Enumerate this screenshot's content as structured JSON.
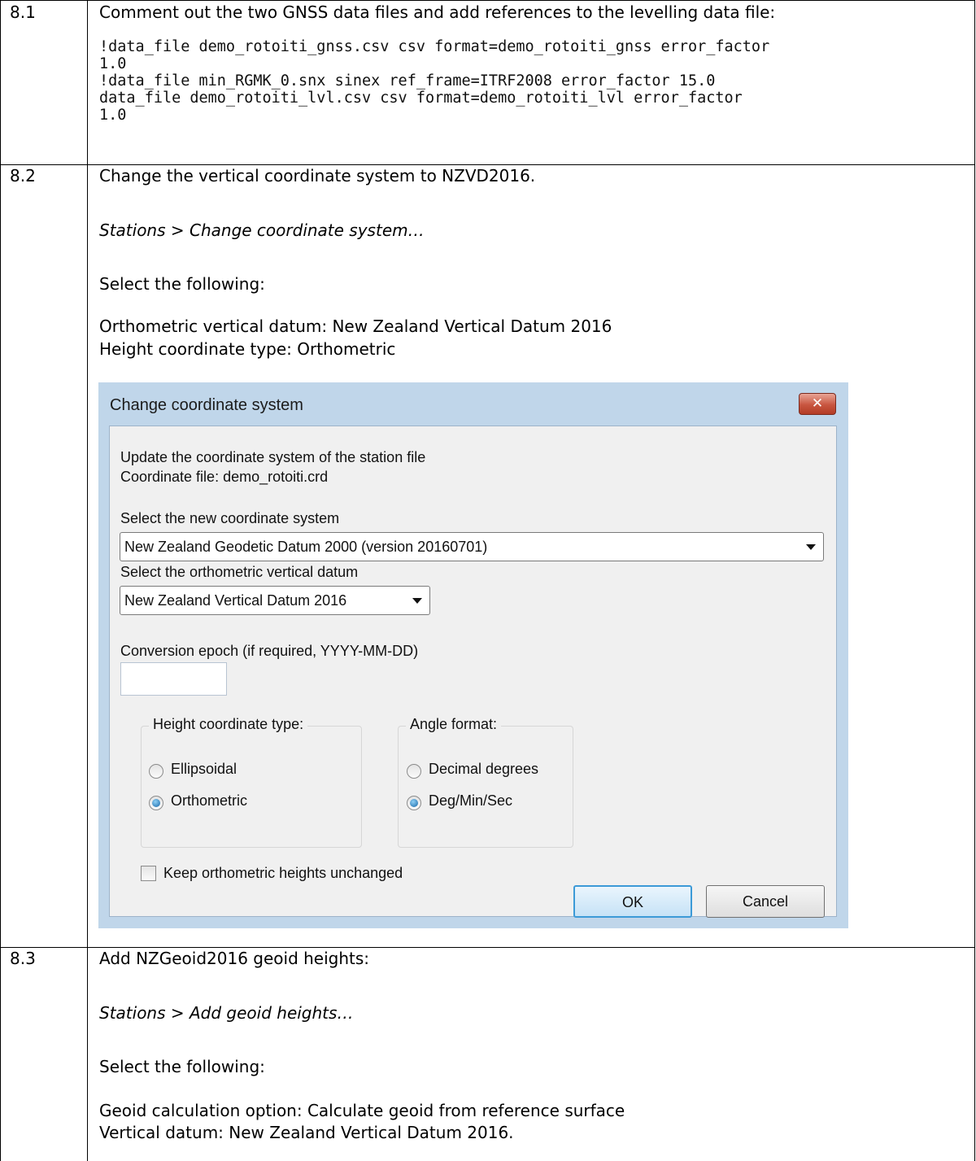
{
  "steps": [
    {
      "number": "8.1",
      "intro": "Comment out the two GNSS data files and add references to the levelling data file:",
      "code_lines": [
        "!data_file demo_rotoiti_gnss.csv csv format=demo_rotoiti_gnss error_factor",
        "1.0",
        "!data_file min_RGMK_0.snx sinex ref_frame=ITRF2008 error_factor 15.0",
        "data_file demo_rotoiti_lvl.csv csv format=demo_rotoiti_lvl error_factor",
        "1.0"
      ]
    },
    {
      "number": "8.2",
      "intro": "Change the vertical coordinate system to NZVD2016.",
      "menu_path": "Stations > Change coordinate system…",
      "select_text": "Select the following:",
      "settings": [
        "Orthometric vertical datum: New Zealand Vertical Datum 2016",
        "Height coordinate type: Orthometric"
      ]
    },
    {
      "number": "8.3",
      "intro": "Add NZGeoid2016 geoid heights:",
      "menu_path": "Stations > Add geoid heights…",
      "select_text": "Select the following:",
      "settings": [
        "Geoid calculation option: Calculate geoid from reference surface",
        "Vertical datum: New Zealand Vertical Datum 2016."
      ]
    }
  ],
  "dialog": {
    "title": "Change coordinate system",
    "close_glyph": "✕",
    "description_line1": "Update the coordinate system of the station file",
    "description_line2": "Coordinate file: demo_rotoiti.crd",
    "coord_system_label": "Select the new coordinate system",
    "coord_system_value": "New Zealand Geodetic Datum 2000 (version 20160701)",
    "vertical_datum_label": "Select the orthometric vertical datum",
    "vertical_datum_value": "New Zealand Vertical Datum 2016",
    "epoch_label": "Conversion epoch (if required, YYYY-MM-DD)",
    "epoch_value": "",
    "height_group": {
      "legend": "Height coordinate type:",
      "options": [
        "Ellipsoidal",
        "Orthometric"
      ],
      "selected": "Orthometric"
    },
    "angle_group": {
      "legend": "Angle format:",
      "options": [
        "Decimal degrees",
        "Deg/Min/Sec"
      ],
      "selected": "Deg/Min/Sec"
    },
    "keep_heights_label": "Keep orthometric heights unchanged",
    "keep_heights_checked": false,
    "ok_label": "OK",
    "cancel_label": "Cancel"
  }
}
